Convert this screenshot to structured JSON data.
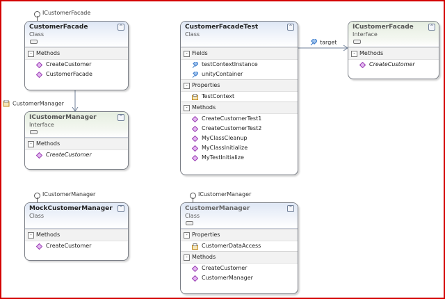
{
  "colors": {
    "frame": "#d40000",
    "method": "#9b3fb5",
    "field": "#3a78c8",
    "property": "#c08a20",
    "connector": "#6f7f98"
  },
  "lollipops": {
    "top_left": "ICustomerFacade",
    "bottom_left": "ICustomerManager",
    "bottom_middle": "ICustomerManager"
  },
  "associations": {
    "customer_manager": "CustomerManager",
    "target": "target"
  },
  "shapes": {
    "customer_facade": {
      "name": "CustomerFacade",
      "stereotype": "Class",
      "sections": {
        "methods": "Methods"
      },
      "methods": [
        "CreateCustomer",
        "CustomerFacade"
      ]
    },
    "icustomer_manager": {
      "name": "ICustomerManager",
      "stereotype": "Interface",
      "sections": {
        "methods": "Methods"
      },
      "methods": [
        "CreateCustomer"
      ]
    },
    "customer_facade_test": {
      "name": "CustomerFacadeTest",
      "stereotype": "Class",
      "sections": {
        "fields": "Fields",
        "properties": "Properties",
        "methods": "Methods"
      },
      "fields": [
        "testContextInstance",
        "unityContainer"
      ],
      "properties": [
        "TestContext"
      ],
      "methods": [
        "CreateCustomerTest1",
        "CreateCustomerTest2",
        "MyClassCleanup",
        "MyClassInitialize",
        "MyTestInitialize"
      ]
    },
    "icustomer_facade": {
      "name": "ICustomerFacade",
      "stereotype": "Interface",
      "sections": {
        "methods": "Methods"
      },
      "methods": [
        "CreateCustomer"
      ]
    },
    "mock_customer_manager": {
      "name": "MockCustomerManager",
      "stereotype": "Class",
      "sections": {
        "methods": "Methods"
      },
      "methods": [
        "CreateCustomer"
      ]
    },
    "customer_manager": {
      "name": "CustomerManager",
      "stereotype": "Class",
      "sections": {
        "properties": "Properties",
        "methods": "Methods"
      },
      "properties": [
        "CustomerDataAccess"
      ],
      "methods": [
        "CreateCustomer",
        "CustomerManager"
      ]
    }
  }
}
